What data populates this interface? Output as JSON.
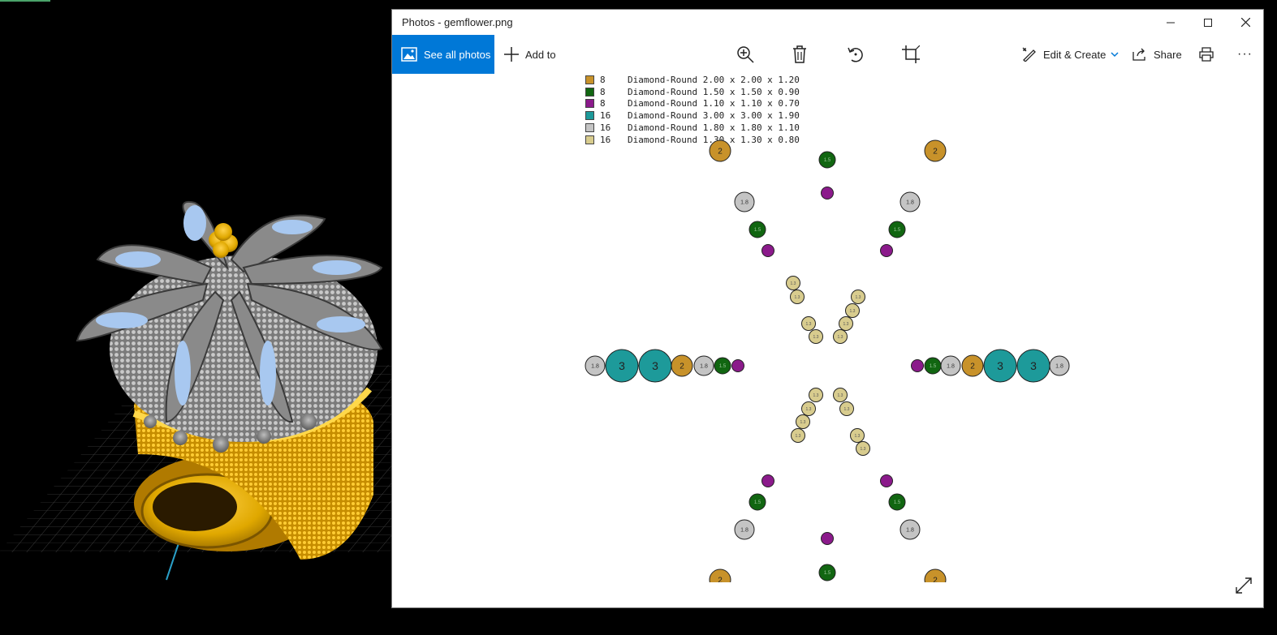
{
  "window": {
    "title": "Photos - gemflower.png",
    "minimize_glyph": "—",
    "maximize_glyph": "☐",
    "close_glyph": "✕"
  },
  "toolbar": {
    "see_all_label": "See all photos",
    "add_to_label": "Add to",
    "edit_create_label": "Edit & Create",
    "share_label": "Share",
    "more_glyph": "···",
    "icons": [
      "zoom-in-icon",
      "delete-icon",
      "rotate-icon",
      "crop-icon",
      "edit-create-icon",
      "share-icon",
      "print-icon",
      "more-icon"
    ]
  },
  "colors": {
    "accent": "#0078d7",
    "gem_2_00": "#c8922a",
    "gem_1_50": "#116611",
    "gem_1_10": "#8b1a8b",
    "gem_3_00": "#1d9a9a",
    "gem_1_80": "#c4c4c4",
    "gem_1_30": "#d8cc8e"
  },
  "legend": [
    {
      "count": "8",
      "desc": "Diamond-Round 2.00 x 2.00 x 1.20",
      "color": "#c8922a"
    },
    {
      "count": "8",
      "desc": "Diamond-Round 1.50 x 1.50 x 0.90",
      "color": "#116611"
    },
    {
      "count": "8",
      "desc": "Diamond-Round 1.10 x 1.10 x 0.70",
      "color": "#8b1a8b"
    },
    {
      "count": "16",
      "desc": "Diamond-Round 3.00 x 3.00 x 1.90",
      "color": "#1d9a9a"
    },
    {
      "count": "16",
      "desc": "Diamond-Round 1.80 x 1.80 x 1.10",
      "color": "#c4c4c4"
    },
    {
      "count": "16",
      "desc": "Diamond-Round 1.30 x 1.30 x 0.80",
      "color": "#d8cc8e"
    }
  ],
  "gem_labels": {
    "size_2_00": "2",
    "size_1_50": "1.5",
    "size_3_00": "3",
    "size_1_80": "1.8",
    "size_1_30": "1.3"
  },
  "cad_view": {
    "description_icon": "ring-3d-model-icon"
  }
}
